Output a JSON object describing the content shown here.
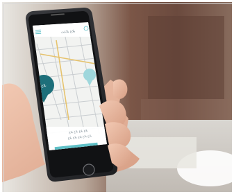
{
  "app": {
    "header_title": "بلاغ بلاغت",
    "pin_label": "بلاغ",
    "info_line": "بلاغ بلاغ بلاغ بلاغ",
    "subinfo_line": "بلاغ بلاغ بلاغ بلاغ بلاغ",
    "bottom_button_label": "بلاغ بلاغ"
  },
  "colors": {
    "accent": "#5fc0c7",
    "pin_dark": "#1d6f7a",
    "pin_light": "#9fd7dc",
    "phone_body": "#2a2b2e",
    "map_bg": "#f2f3f1",
    "background_wall": "#6c4a3d"
  }
}
